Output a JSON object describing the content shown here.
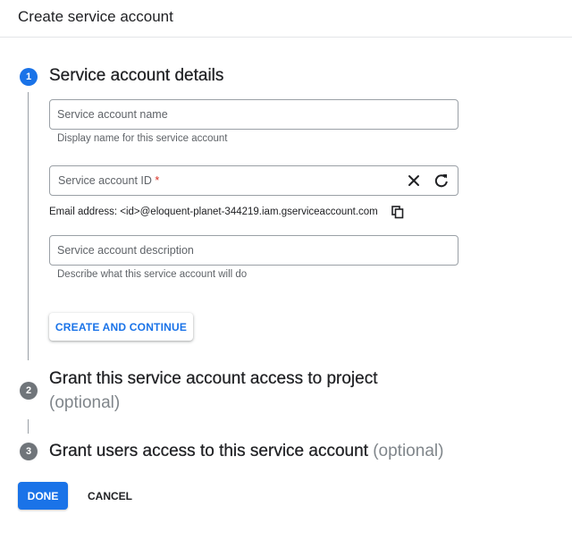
{
  "header": {
    "title": "Create service account"
  },
  "steps": [
    {
      "number": "1",
      "title": "Service account details",
      "state": "active"
    },
    {
      "number": "2",
      "title": "Grant this service account access to project",
      "optional": "(optional)",
      "state": "inactive"
    },
    {
      "number": "3",
      "title": "Grant users access to this service account",
      "optional": "(optional)",
      "state": "inactive"
    }
  ],
  "form": {
    "name_field": {
      "value": "",
      "placeholder": "Service account name",
      "hint": "Display name for this service account"
    },
    "id_field": {
      "value": "",
      "placeholder": "Service account ID",
      "required_marker": "*",
      "icons": [
        "clear-icon",
        "refresh-icon"
      ]
    },
    "email_line": "Email address: <id>@eloquent-planet-344219.iam.gserviceaccount.com",
    "description_field": {
      "value": "",
      "placeholder": "Service account description",
      "hint": "Describe what this service account will do"
    },
    "create_button": "CREATE AND CONTINUE"
  },
  "footer": {
    "done_label": "DONE",
    "cancel_label": "CANCEL"
  },
  "colors": {
    "primary": "#1a73e8",
    "inactive_step": "#70757a",
    "required": "#d93025",
    "muted_text": "#5f6368"
  }
}
